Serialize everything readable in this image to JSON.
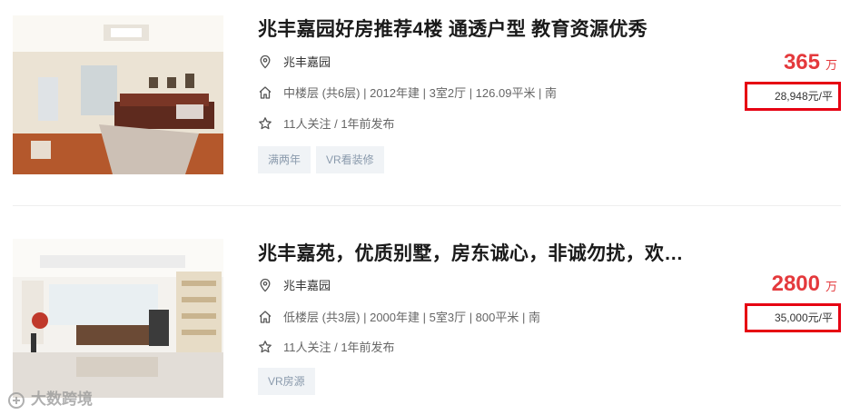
{
  "listings": [
    {
      "title": "兆丰嘉园好房推荐4楼 通透户型 教育资源优秀",
      "community": "兆丰嘉园",
      "house_info": "中楼层 (共6层) | 2012年建 | 3室2厅 | 126.09平米 | 南",
      "follow_info": "11人关注 / 1年前发布",
      "tags": [
        "满两年",
        "VR看装修"
      ],
      "total_price": "365",
      "total_unit": "万",
      "unit_price": "28,948元/平"
    },
    {
      "title": "兆丰嘉苑，优质别墅，房东诚心，非诚勿扰，欢…",
      "community": "兆丰嘉园",
      "house_info": "低楼层 (共3层) | 2000年建 | 5室3厅 | 800平米 | 南",
      "follow_info": "11人关注 / 1年前发布",
      "tags": [
        "VR房源"
      ],
      "total_price": "2800",
      "total_unit": "万",
      "unit_price": "35,000元/平"
    }
  ],
  "watermark": "大数跨境",
  "icons": {
    "community": "location-pin-icon",
    "house_info": "home-icon",
    "follow": "star-icon"
  },
  "colors": {
    "price": "#e4393c",
    "highlight_box": "#e60012",
    "tag_bg": "#f0f3f6",
    "tag_text": "#8a9aac"
  }
}
